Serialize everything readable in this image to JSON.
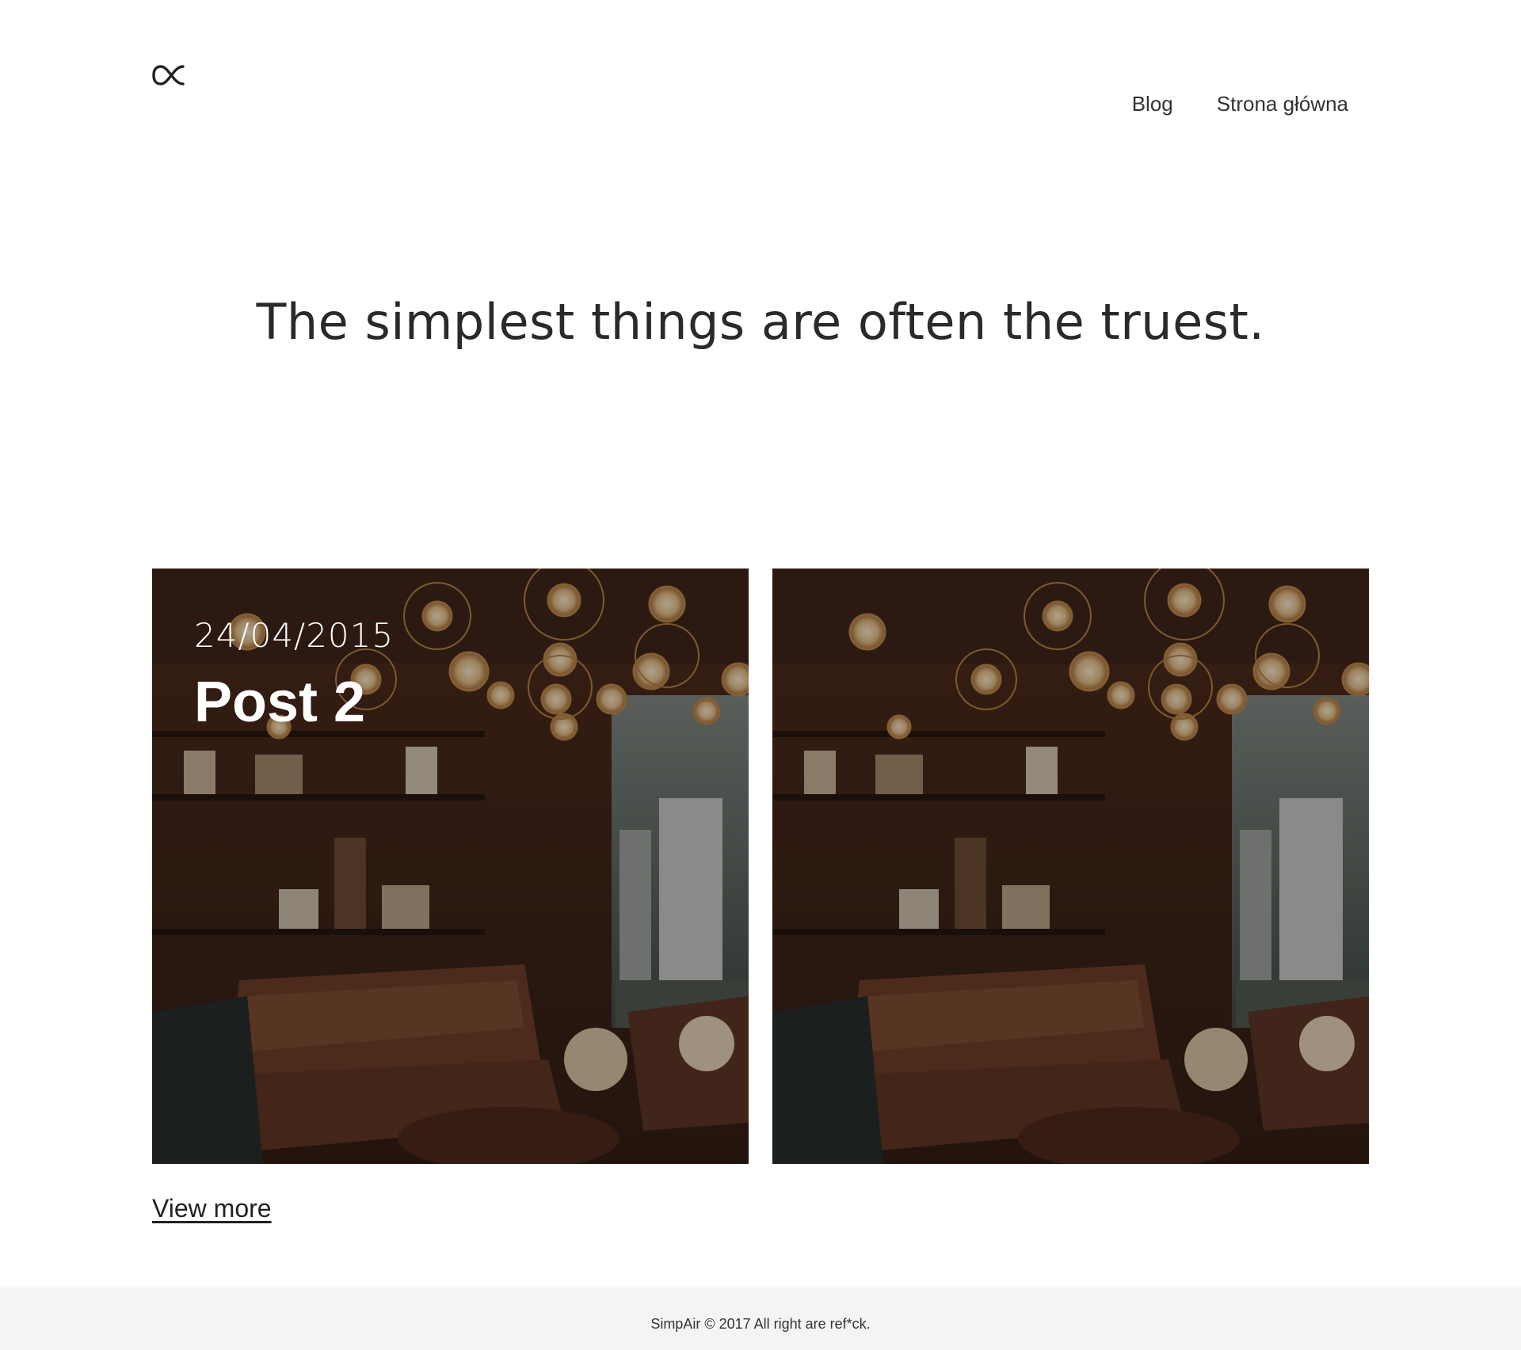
{
  "header": {
    "logo_icon": "alpha-proportional-icon",
    "nav": [
      {
        "label": "Blog"
      },
      {
        "label": "Strona główna"
      }
    ]
  },
  "hero": {
    "tagline": "The simplest things are often the truest."
  },
  "posts": [
    {
      "date": "24/04/2015",
      "title": "Post 2"
    },
    {
      "date": "",
      "title": ""
    }
  ],
  "view_more_label": "View more",
  "footer": {
    "text": "SimpAir © 2017 All right are ref*ck."
  }
}
